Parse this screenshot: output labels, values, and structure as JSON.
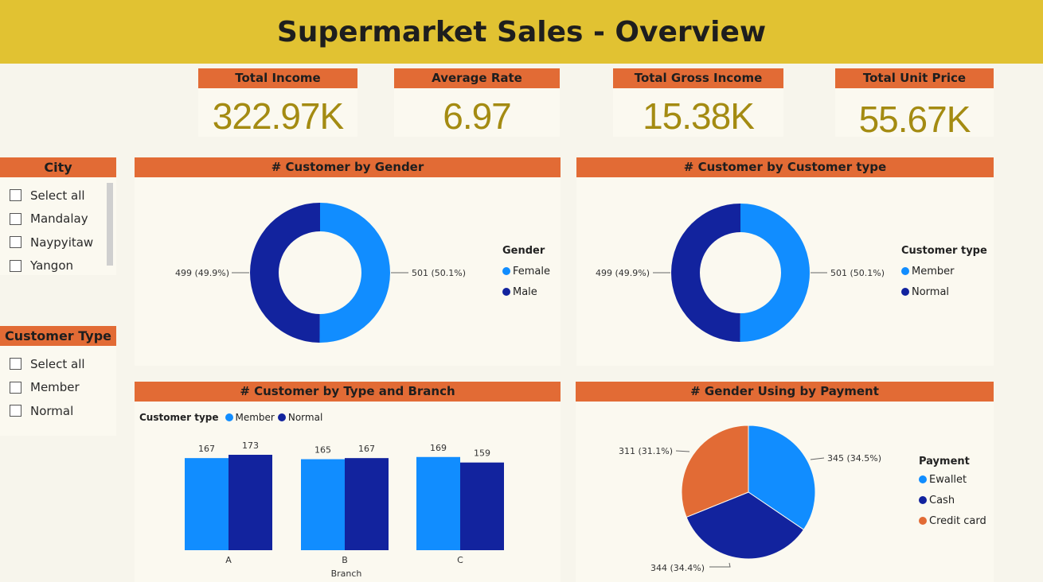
{
  "title": "Supermarket Sales - Overview",
  "colors": {
    "header": "#e1c232",
    "accent": "#e26b35",
    "light_blue": "#118dff",
    "dark_blue": "#12239e",
    "kpi_value": "#a48b12"
  },
  "kpis": [
    {
      "label": "Total Income",
      "value": "322.97K"
    },
    {
      "label": "Average Rate",
      "value": "6.97"
    },
    {
      "label": "Total Gross Income",
      "value": "15.38K"
    },
    {
      "label": "Total Unit Price",
      "value": "55.67K"
    }
  ],
  "slicers": {
    "city": {
      "title": "City",
      "items": [
        "Select all",
        "Mandalay",
        "Naypyitaw",
        "Yangon"
      ]
    },
    "customer_type": {
      "title": "Customer Type",
      "items": [
        "Select all",
        "Member",
        "Normal"
      ]
    }
  },
  "visuals": {
    "gender": {
      "title": "# Customer by Gender",
      "legend_title": "Gender"
    },
    "customer_type": {
      "title": "# Customer by Customer type",
      "legend_title": "Customer type"
    },
    "type_branch": {
      "title": "# Customer by Type and Branch",
      "legend_title": "Customer type",
      "xlabel": "Branch"
    },
    "payment": {
      "title": "# Gender Using by Payment",
      "legend_title": "Payment"
    }
  },
  "chart_data": [
    {
      "type": "pie",
      "variant": "donut",
      "title": "# Customer by Gender",
      "legend_title": "Gender",
      "categories": [
        "Female",
        "Male"
      ],
      "values": [
        501,
        499
      ],
      "labels": [
        "501 (50.1%)",
        "499 (49.9%)"
      ],
      "colors": [
        "#118dff",
        "#12239e"
      ]
    },
    {
      "type": "pie",
      "variant": "donut",
      "title": "# Customer by Customer type",
      "legend_title": "Customer type",
      "categories": [
        "Member",
        "Normal"
      ],
      "values": [
        501,
        499
      ],
      "labels": [
        "501 (50.1%)",
        "499 (49.9%)"
      ],
      "colors": [
        "#118dff",
        "#12239e"
      ]
    },
    {
      "type": "bar",
      "title": "# Customer by Type and Branch",
      "legend_title": "Customer type",
      "categories": [
        "A",
        "B",
        "C"
      ],
      "xlabel": "Branch",
      "series": [
        {
          "name": "Member",
          "values": [
            167,
            165,
            169
          ],
          "color": "#118dff"
        },
        {
          "name": "Normal",
          "values": [
            173,
            167,
            159
          ],
          "color": "#12239e"
        }
      ],
      "ylim": [
        0,
        173
      ]
    },
    {
      "type": "pie",
      "title": "# Gender Using by Payment",
      "legend_title": "Payment",
      "categories": [
        "Ewallet",
        "Cash",
        "Credit card"
      ],
      "values": [
        345,
        344,
        311
      ],
      "labels": [
        "345 (34.5%)",
        "344 (34.4%)",
        "311 (31.1%)"
      ],
      "colors": [
        "#118dff",
        "#12239e",
        "#e26b35"
      ]
    }
  ]
}
